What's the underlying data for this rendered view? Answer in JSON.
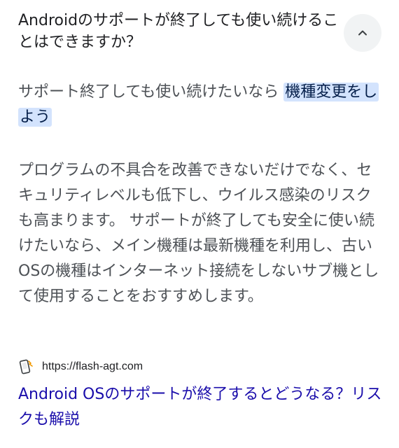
{
  "faq": {
    "question": "Androidのサポートが終了しても使い続けることはできますか？",
    "collapse_icon": "chevron-up-icon"
  },
  "answer": {
    "lead_plain": "サポート終了しても使い続けたいなら",
    "lead_highlight": "機種変更をしよう",
    "snippet": "プログラムの不具合を改善できないだけでなく、セキュリティレベルも低下し、ウイルス感染のリスクも高まります。 サポートが終了しても安全に使い続けたいなら、メイン機種は最新機種を利用し、古いOSの機種はインターネット接続をしないサブ機として使用することをおすすめします。"
  },
  "source": {
    "favicon": "phone-favicon-icon",
    "url": "https://flash-agt.com",
    "link_title": "Android OSのサポートが終了するとどうなる？リスクも解説"
  },
  "colors": {
    "highlight_bg": "#d3e3fd",
    "link": "#1a0dab",
    "body_text": "#4d5156"
  }
}
